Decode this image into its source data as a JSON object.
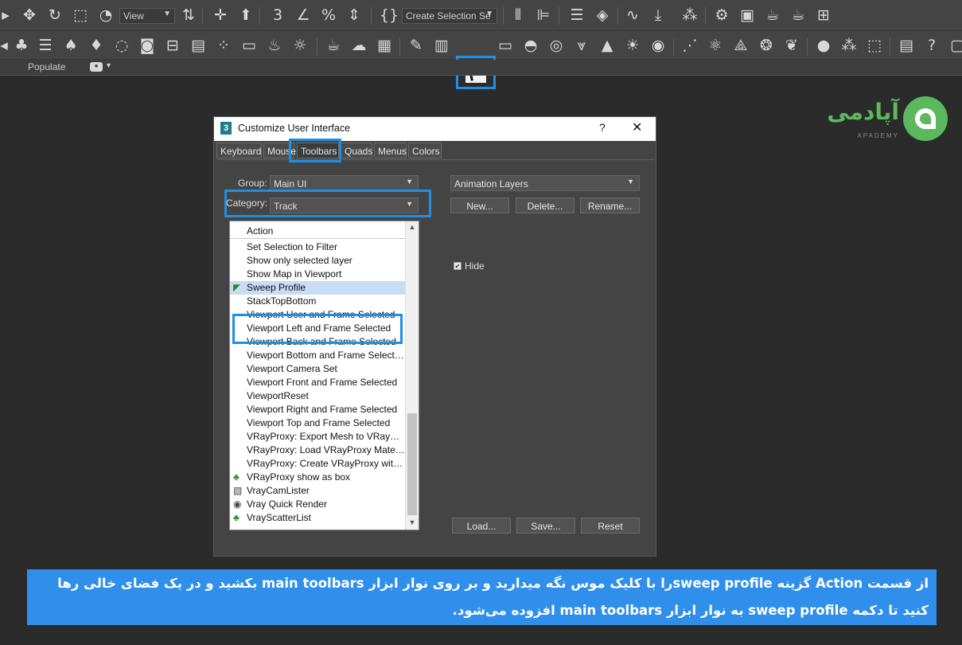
{
  "toolbar": {
    "view_dropdown": "View",
    "selection_set_dropdown": "Create Selection Se"
  },
  "populate_bar": {
    "label": "Populate"
  },
  "logo": {
    "text": "آپادمی",
    "subtext": "APADEMY"
  },
  "dialog": {
    "title": "Customize User Interface",
    "help": "?",
    "close": "✕",
    "tabs": [
      "Keyboard",
      "Mouse",
      "Toolbars",
      "Quads",
      "Menus",
      "Colors"
    ],
    "active_tab": "Toolbars",
    "group_label": "Group:",
    "group_value": "Main UI",
    "category_label": "Category:",
    "category_value": "Track",
    "list_header": "Action",
    "actions": [
      "Set Selection to Filter",
      "Show only selected layer",
      "Show Map in Viewport",
      "Sweep Profile",
      "StackTopBottom",
      "Viewport User and Frame Selected",
      "Viewport Left and Frame Selected",
      "Viewport Back and Frame Selected",
      "Viewport Bottom and Frame Selected",
      "Viewport Camera Set",
      "Viewport Front and Frame Selected",
      "ViewportReset",
      "Viewport Right and Frame Selected",
      "Viewport Top and Frame Selected",
      "VRayProxy: Export Mesh to VRayPro...",
      "VRayProxy: Load VRayProxy Material...",
      "VRayProxy: Create VRayProxy with ...",
      "VRayProxy show as box",
      "VrayCamLister",
      "Vray Quick Render",
      "VrayScatterList"
    ],
    "selected_action": "Sweep Profile",
    "toolbar_dropdown": "Animation Layers",
    "new_button": "New...",
    "delete_button": "Delete...",
    "rename_button": "Rename...",
    "hide_label": "Hide",
    "hide_checked": true,
    "load_button": "Load...",
    "save_button": "Save...",
    "reset_button": "Reset"
  },
  "caption": {
    "line1": "از قسمت Action گزینه  sweep profileرا با کلیک موس نگه میدارید و بر روی نوار ابزار main toolbars بکشید و در یک فضای خالی رها",
    "line2": "کنید تا دکمه sweep profile به نوار ابزار main toolbars افزوده می‌شود."
  },
  "colors": {
    "highlight": "#1e8fe6",
    "brand_green": "#5cb85c",
    "caption_bg": "#2f8fea"
  }
}
